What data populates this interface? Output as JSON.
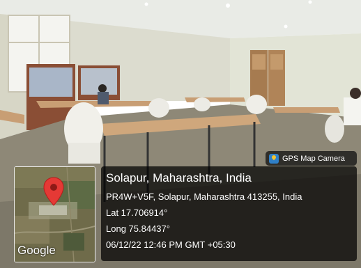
{
  "badge": {
    "label": "GPS Map Camera",
    "icon": "gps-map-camera-icon"
  },
  "location": {
    "title": "Solapur, Maharashtra, India",
    "address": "PR4W+V5F, Solapur, Maharashtra 413255, India",
    "lat": "Lat 17.706914°",
    "long": "Long 75.84437°",
    "datetime": "06/12/22 12:46 PM GMT +05:30"
  },
  "map": {
    "brand": "Google",
    "marker_icon": "map-pin-icon",
    "marker_color": "#e53935"
  }
}
